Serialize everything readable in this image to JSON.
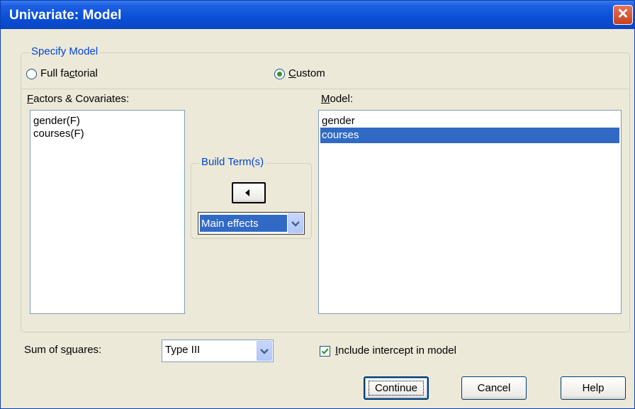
{
  "window": {
    "title": "Univariate: Model",
    "close_symbol": "✕"
  },
  "specify_model": {
    "legend": "Specify Model",
    "full_factorial_pre": "Full fa",
    "full_factorial_acc": "c",
    "full_factorial_post": "torial",
    "custom_acc": "C",
    "custom_post": "ustom",
    "selected": "Custom"
  },
  "factors": {
    "label_acc": "F",
    "label_post": "actors & Covariates:",
    "items": [
      "gender(F)",
      "courses(F)"
    ]
  },
  "model": {
    "label_acc": "M",
    "label_post": "odel:",
    "items": [
      "gender",
      "courses"
    ],
    "selected_index": 1
  },
  "build_terms": {
    "legend": "Build Term(s)",
    "dropdown_value": "Main effects"
  },
  "sum_of_squares": {
    "label_pre": "Sum of s",
    "label_acc": "q",
    "label_post": "uares:",
    "value": "Type III"
  },
  "include_intercept": {
    "label_acc": "I",
    "label_post": "nclude intercept in model",
    "checked": true
  },
  "buttons": {
    "continue": "Continue",
    "cancel": "Cancel",
    "help": "Help"
  }
}
